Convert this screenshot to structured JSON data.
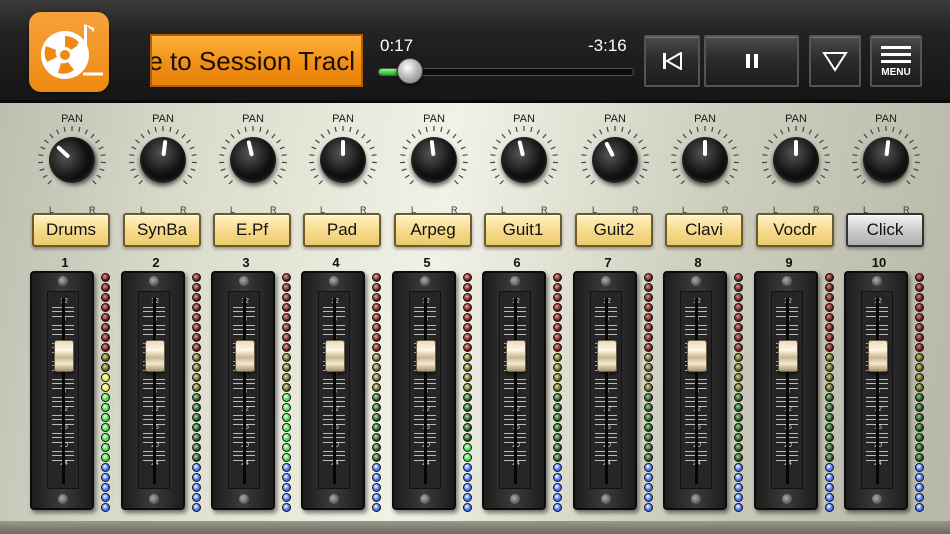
{
  "header": {
    "scrolling_title": "e to Session Tracl",
    "time_elapsed": "0:17",
    "time_remaining": "-3:16",
    "progress": 0.09,
    "buttons": {
      "previous": "skip-back-icon",
      "pause": "pause-icon",
      "dropdown": "triangle-down-icon",
      "menu_label": "MENU"
    }
  },
  "colors": {
    "accent_orange": "#ee8a12",
    "led_red": "#c01010",
    "led_yellow": "#e8e020",
    "led_green": "#2ea82e",
    "led_blue": "#2040c8"
  },
  "channels": [
    {
      "num": "1",
      "pan_label": "PAN",
      "left": "L",
      "right": "R",
      "name": "Drums",
      "style": "gold",
      "pan": -0.35,
      "fader_db": 0,
      "meter_lit": 9
    },
    {
      "num": "2",
      "pan_label": "PAN",
      "left": "L",
      "right": "R",
      "name": "SynBa",
      "style": "gold",
      "pan": 0.05,
      "fader_db": 0,
      "meter_lit": 0
    },
    {
      "num": "3",
      "pan_label": "PAN",
      "left": "L",
      "right": "R",
      "name": "E.Pf",
      "style": "gold",
      "pan": -0.1,
      "fader_db": 0,
      "meter_lit": 7
    },
    {
      "num": "4",
      "pan_label": "PAN",
      "left": "L",
      "right": "R",
      "name": "Pad",
      "style": "gold",
      "pan": 0.0,
      "fader_db": 0,
      "meter_lit": 0
    },
    {
      "num": "5",
      "pan_label": "PAN",
      "left": "L",
      "right": "R",
      "name": "Arpeg",
      "style": "gold",
      "pan": -0.05,
      "fader_db": 0,
      "meter_lit": 2
    },
    {
      "num": "6",
      "pan_label": "PAN",
      "left": "L",
      "right": "R",
      "name": "Guit1",
      "style": "gold",
      "pan": -0.1,
      "fader_db": 0,
      "meter_lit": 0
    },
    {
      "num": "7",
      "pan_label": "PAN",
      "left": "L",
      "right": "R",
      "name": "Guit2",
      "style": "gold",
      "pan": -0.2,
      "fader_db": 0,
      "meter_lit": 0
    },
    {
      "num": "8",
      "pan_label": "PAN",
      "left": "L",
      "right": "R",
      "name": "Clavi",
      "style": "gold",
      "pan": 0.0,
      "fader_db": 0,
      "meter_lit": 0
    },
    {
      "num": "9",
      "pan_label": "PAN",
      "left": "L",
      "right": "R",
      "name": "Vocdr",
      "style": "gold",
      "pan": 0.0,
      "fader_db": 0,
      "meter_lit": 0
    },
    {
      "num": "10",
      "pan_label": "PAN",
      "left": "L",
      "right": "R",
      "name": "Click",
      "style": "grey",
      "pan": 0.05,
      "fader_db": 0,
      "meter_lit": 0
    }
  ],
  "fader_scale": [
    "12",
    "8",
    "4",
    "0",
    "4",
    "8",
    "12",
    "16",
    "20",
    "24"
  ]
}
